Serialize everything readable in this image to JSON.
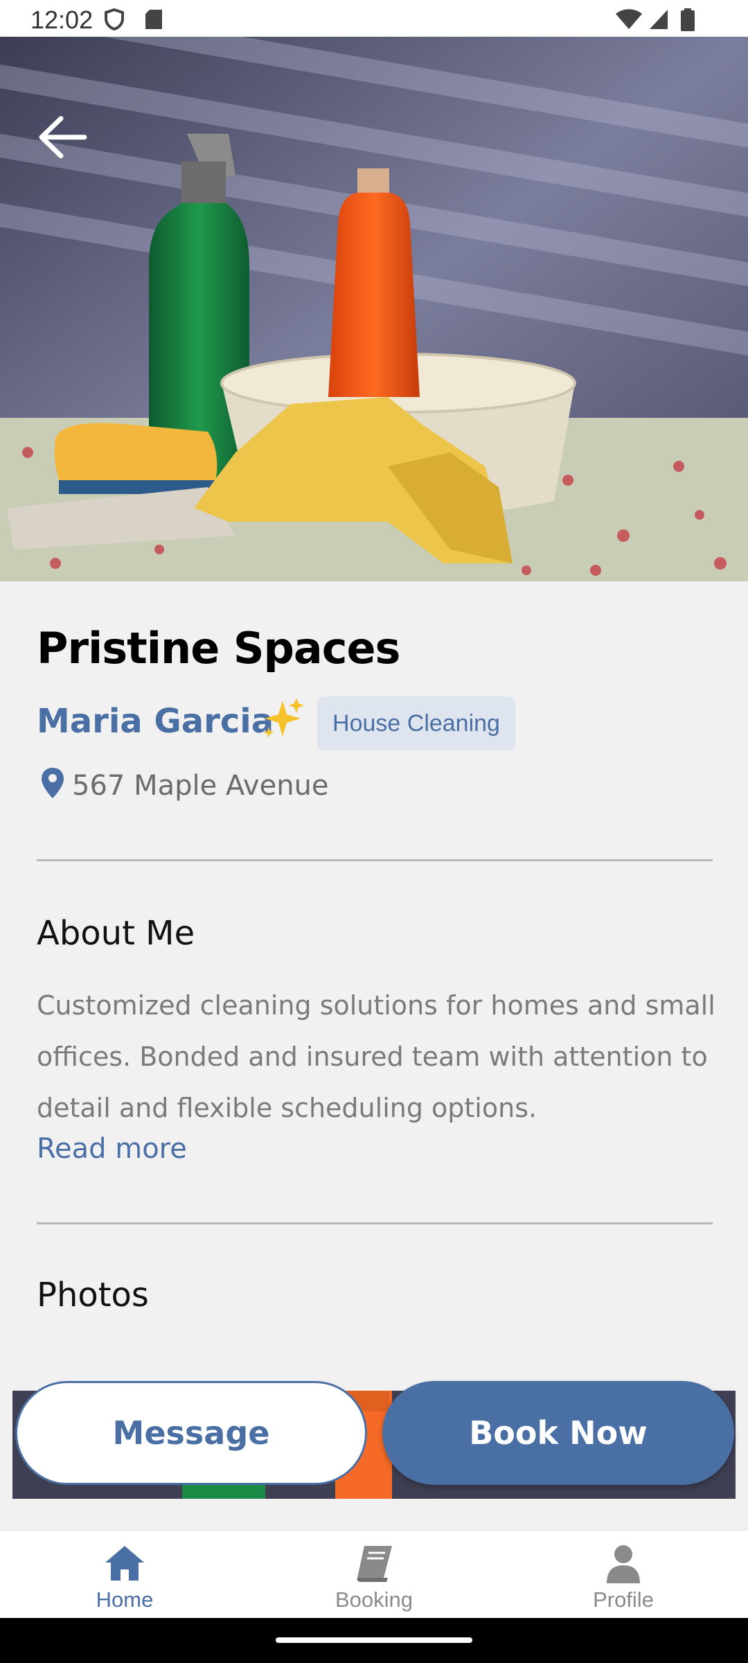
{
  "status_bar": {
    "time": "12:02"
  },
  "provider": {
    "business_name": "Pristine Spaces",
    "owner_name": "Maria Garcia",
    "category": "House Cleaning",
    "address": "567 Maple Avenue"
  },
  "about": {
    "heading": "About Me",
    "text": "Customized cleaning solutions for homes and small offices. Bonded and insured team with attention to detail and flexible scheduling options.",
    "read_more": "Read more"
  },
  "photos": {
    "heading": "Photos"
  },
  "actions": {
    "message": "Message",
    "book": "Book Now"
  },
  "nav": [
    {
      "label": "Home",
      "icon": "home-icon",
      "active": true
    },
    {
      "label": "Booking",
      "icon": "book-icon",
      "active": false
    },
    {
      "label": "Profile",
      "icon": "person-icon",
      "active": false
    }
  ],
  "colors": {
    "accent": "#4a6fa5",
    "chip_bg": "#dfe5ee",
    "inactive": "#8a8a8a"
  }
}
